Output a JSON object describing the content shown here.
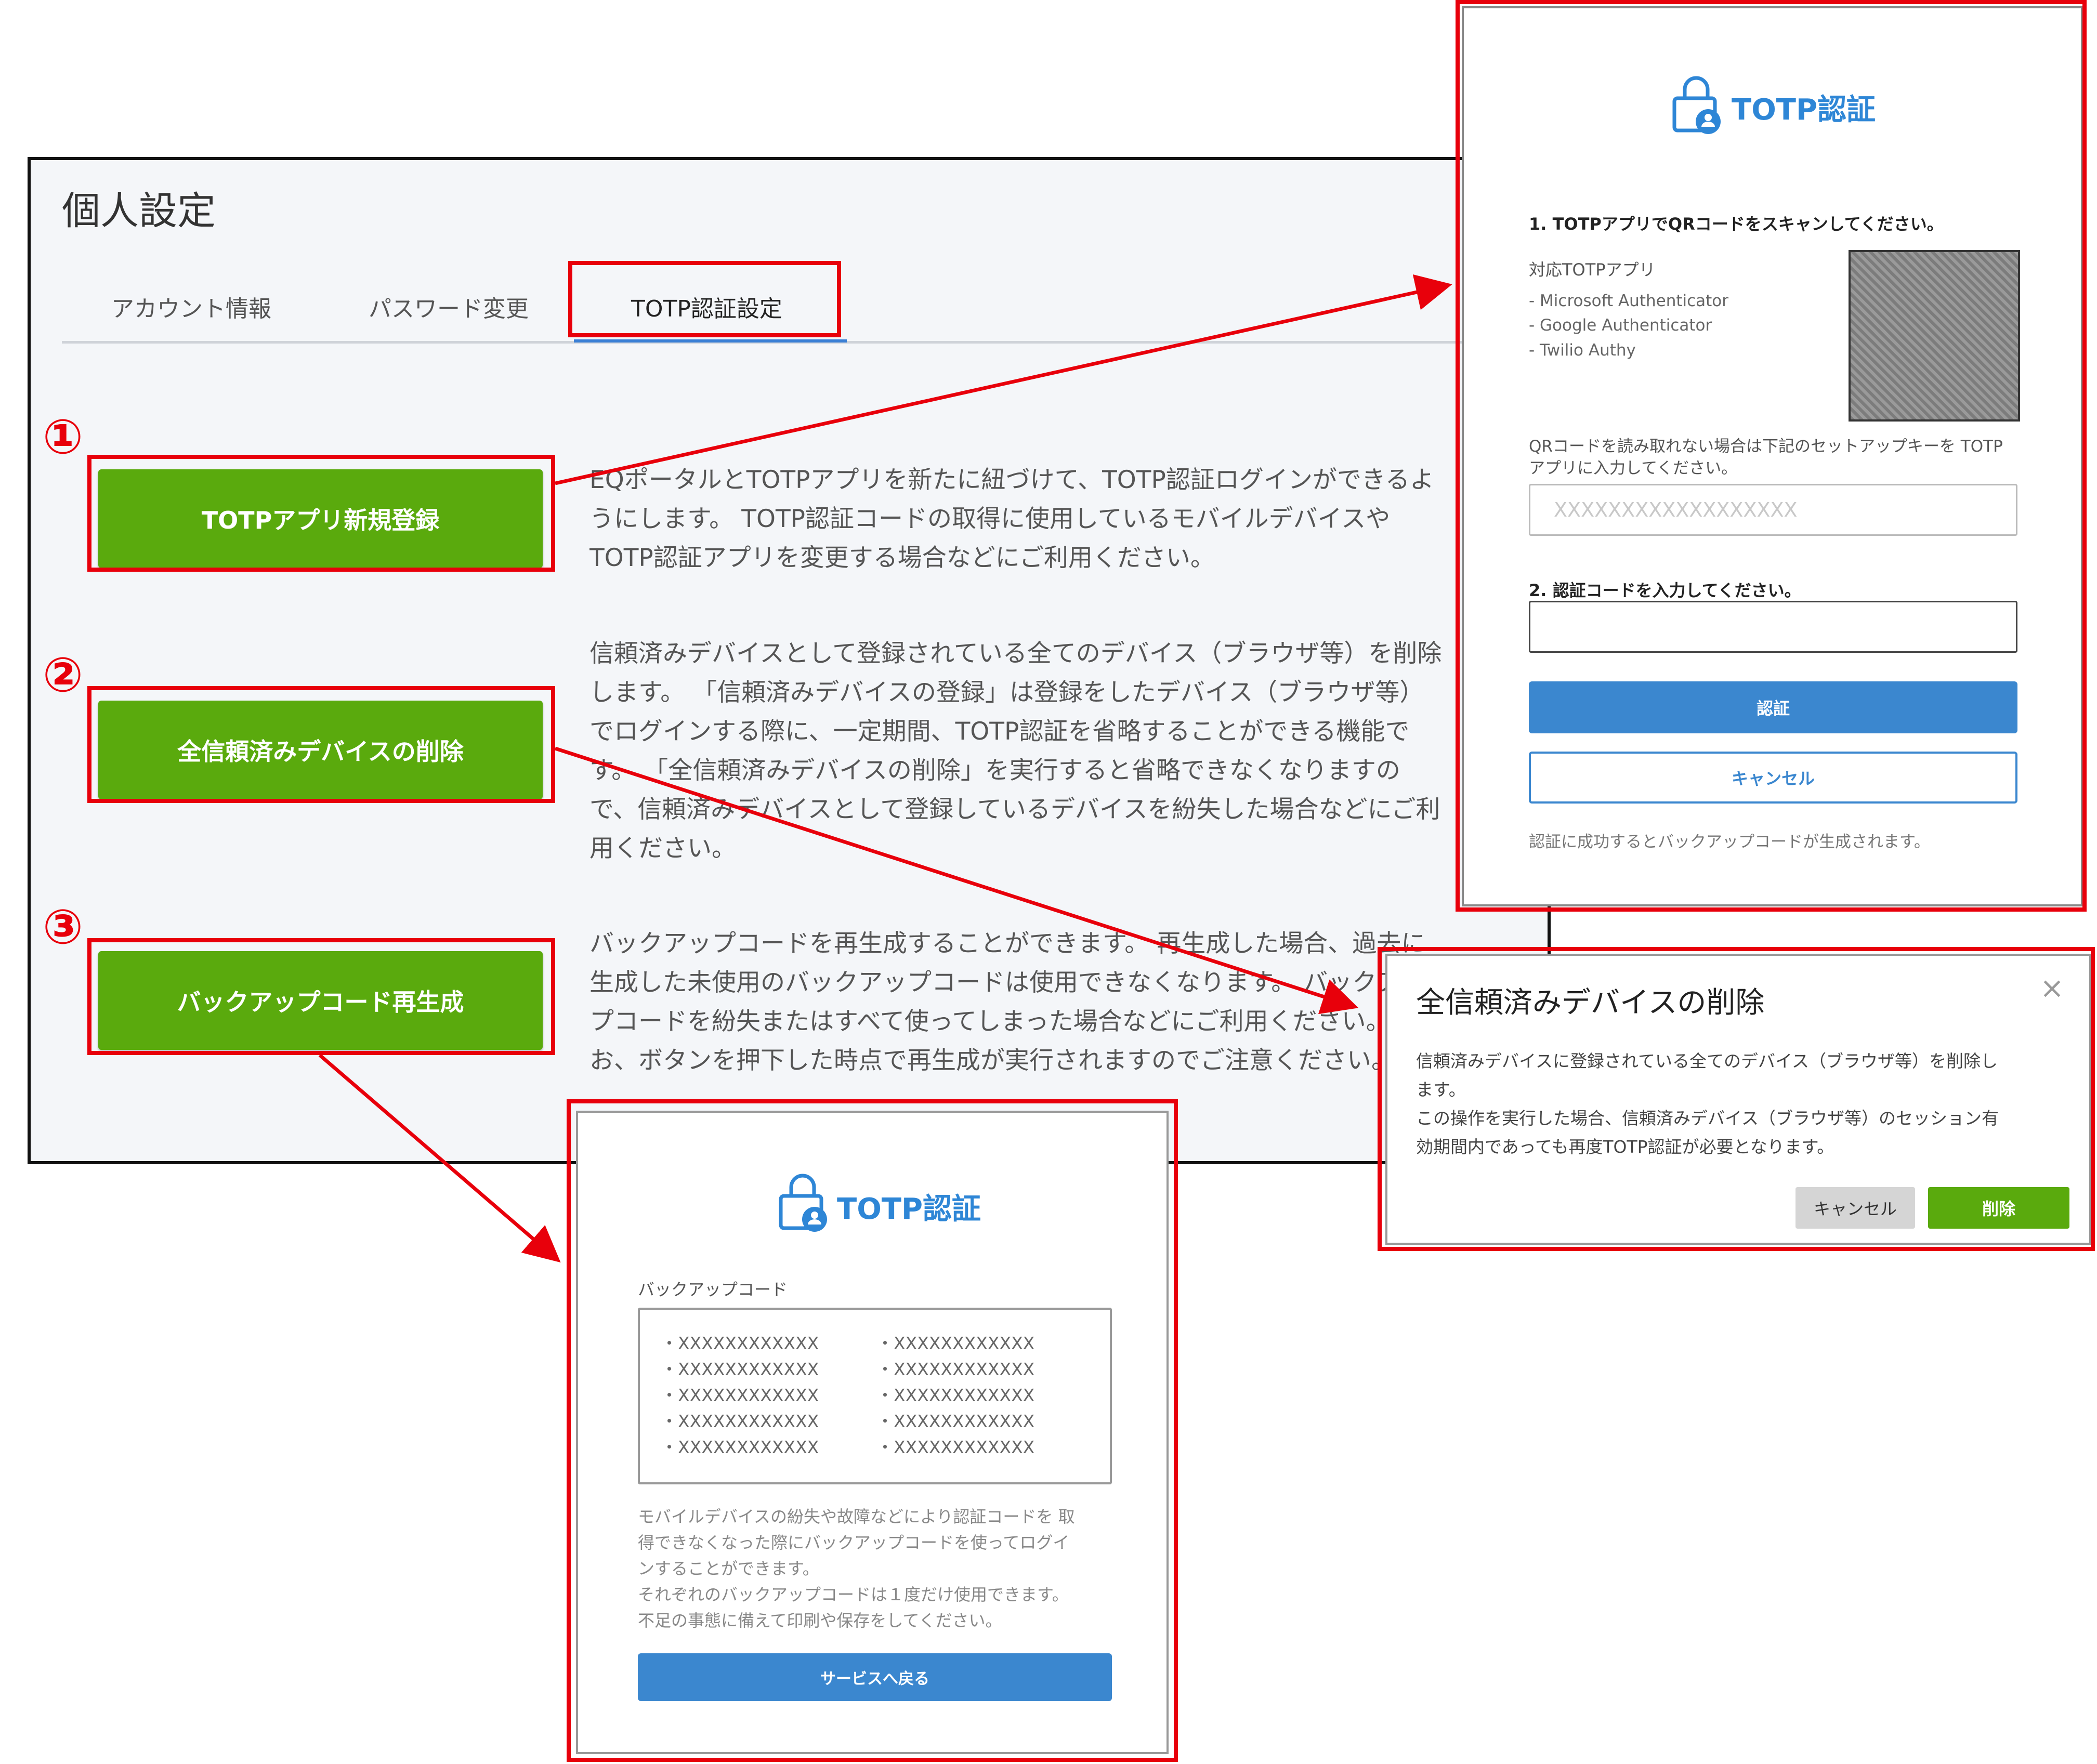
{
  "settings": {
    "title": "個人設定",
    "tabs": [
      "アカウント情報",
      "パスワード変更",
      "TOTP認証設定"
    ],
    "numbers": [
      "①",
      "②",
      "③"
    ],
    "actions": [
      {
        "label": "TOTPアプリ新規登録",
        "desc": [
          "EQポータルとTOTPアプリを新たに紐づけて、TOTP認証ログインができるよ",
          "うにします。 TOTP認証コードの取得に使用しているモバイルデバイスや",
          "TOTP認証アプリを変更する場合などにご利用ください。"
        ]
      },
      {
        "label": "全信頼済みデバイスの削除",
        "desc": [
          "信頼済みデバイスとして登録されている全てのデバイス（ブラウザ等）を削除",
          "します。 「信頼済みデバイスの登録」は登録をしたデバイス（ブラウザ等）",
          "でログインする際に、一定期間、TOTP認証を省略することができる機能で",
          "す。 「全信頼済みデバイスの削除」を実行すると省略できなくなりますの",
          "で、信頼済みデバイスとして登録しているデバイスを紛失した場合などにご利",
          "用ください。"
        ]
      },
      {
        "label": "バックアップコード再生成",
        "desc": [
          "バックアップコードを再生成することができます。 再生成した場合、過去に",
          "生成した未使用のバックアップコードは使用できなくなります。 バックアッ",
          "プコードを紛失またはすべて使ってしまった場合などにご利用ください。な",
          "お、ボタンを押下した時点で再生成が実行されますのでご注意ください。"
        ]
      }
    ]
  },
  "totp": {
    "title": "TOTP認証",
    "step1": "1. TOTPアプリでQRコードをスキャンしてください。",
    "apps_label": "対応TOTPアプリ",
    "apps": [
      "- Microsoft Authenticator",
      "- Google Authenticator",
      "- Twilio Authy"
    ],
    "setup_note": [
      "QRコードを読み取れない場合は下記のセットアップキーを TOTP",
      "アプリに入力してください。"
    ],
    "setup_key": "XXXXXXXXXXXXXXXXXX",
    "step2": "2. 認証コードを入力してください。",
    "code_value": "",
    "verify_label": "認証",
    "cancel_label": "キャンセル",
    "footer": "認証に成功するとバックアップコードが生成されます。"
  },
  "delete_dialog": {
    "title": "全信頼済みデバイスの削除",
    "close": "×",
    "body": [
      "信頼済みデバイスに登録されている全てのデバイス（ブラウザ等）を削除し",
      "ます。",
      "この操作を実行した場合、信頼済みデバイス（ブラウザ等）のセッション有",
      "効期間内であっても再度TOTP認証が必要となります。"
    ],
    "cancel_label": "キャンセル",
    "delete_label": "削除"
  },
  "backup": {
    "title": "TOTP認証",
    "codes_label": "バックアップコード",
    "codes": [
      "・XXXXXXXXXXXX",
      "・XXXXXXXXXXXX",
      "・XXXXXXXXXXXX",
      "・XXXXXXXXXXXX",
      "・XXXXXXXXXXXX",
      "・XXXXXXXXXXXX",
      "・XXXXXXXXXXXX",
      "・XXXXXXXXXXXX",
      "・XXXXXXXXXXXX",
      "・XXXXXXXXXXXX"
    ],
    "note": [
      "モバイルデバイスの紛失や故障などにより認証コードを 取",
      "得できなくなった際にバックアップコードを使ってログイ",
      "ンすることができます。",
      "それぞれのバックアップコードは１度だけ使用できます。",
      "不足の事態に備えて印刷や保存をしてください。"
    ],
    "return_label": "サービスへ戻る"
  },
  "colors": {
    "accent_green": "#5aaa0d",
    "highlight_red": "#e8000b",
    "primary_blue": "#3b87cf"
  }
}
